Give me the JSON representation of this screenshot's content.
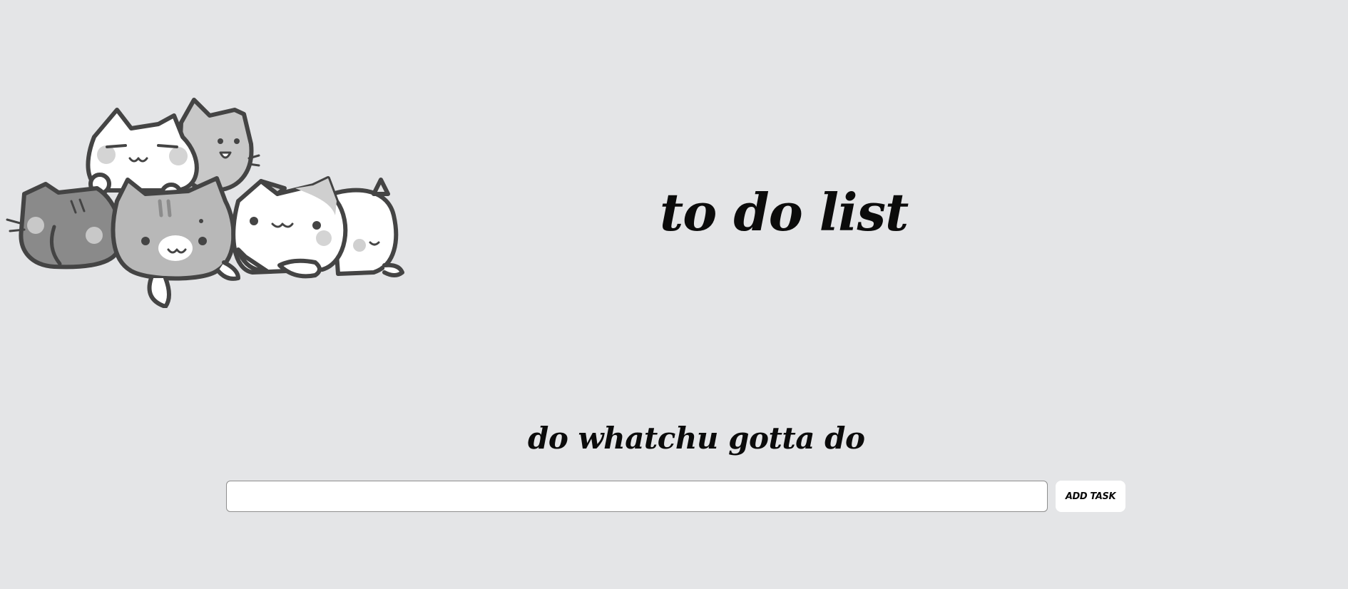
{
  "header": {
    "title": "to do list",
    "illustration_icon": "cats-pile-illustration"
  },
  "main": {
    "subtitle": "do whatchu gotta do",
    "task_input": {
      "value": "",
      "placeholder": ""
    },
    "add_button_label": "ADD TASK"
  },
  "colors": {
    "background": "#e4e5e7",
    "text": "#0b0b0b",
    "input_background": "#ffffff",
    "button_background": "#ffffff"
  }
}
